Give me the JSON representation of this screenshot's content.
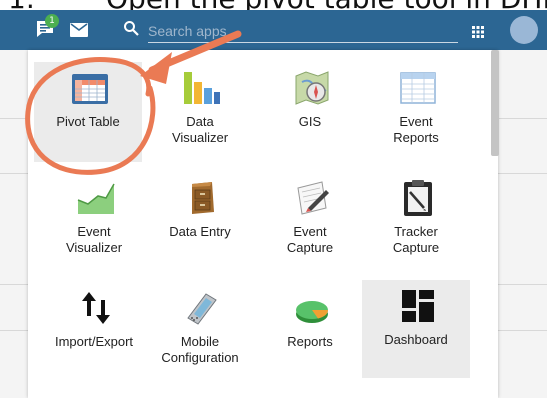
{
  "caption": {
    "number": "1.",
    "text": "Open the pivot table tool in DHIS"
  },
  "header": {
    "chat_badge": "1",
    "search_placeholder": "Search apps"
  },
  "apps": [
    {
      "label": "Pivot Table",
      "icon": "pivot-table-icon",
      "highlighted": true
    },
    {
      "label": "Data Visualizer",
      "icon": "bar-chart-icon",
      "highlighted": false
    },
    {
      "label": "GIS",
      "icon": "map-compass-icon",
      "highlighted": false
    },
    {
      "label": "Event Reports",
      "icon": "spreadsheet-icon",
      "highlighted": false
    },
    {
      "label": "Event Visualizer",
      "icon": "area-chart-icon",
      "highlighted": false
    },
    {
      "label": "Data Entry",
      "icon": "filing-cabinet-icon",
      "highlighted": false
    },
    {
      "label": "Event Capture",
      "icon": "paper-pen-icon",
      "highlighted": false
    },
    {
      "label": "Tracker Capture",
      "icon": "clipboard-icon",
      "highlighted": false
    },
    {
      "label": "Import/Export",
      "icon": "up-down-arrows-icon",
      "highlighted": false
    },
    {
      "label": "Mobile Configuration",
      "icon": "mobile-phone-icon",
      "highlighted": false
    },
    {
      "label": "Reports",
      "icon": "pie-chart-icon",
      "highlighted": false
    },
    {
      "label": "Dashboard",
      "icon": "dashboard-grid-icon",
      "highlighted": true
    }
  ],
  "colors": {
    "header": "#2c6693",
    "annotation": "#ea7a54",
    "highlight": "#ebebeb"
  }
}
